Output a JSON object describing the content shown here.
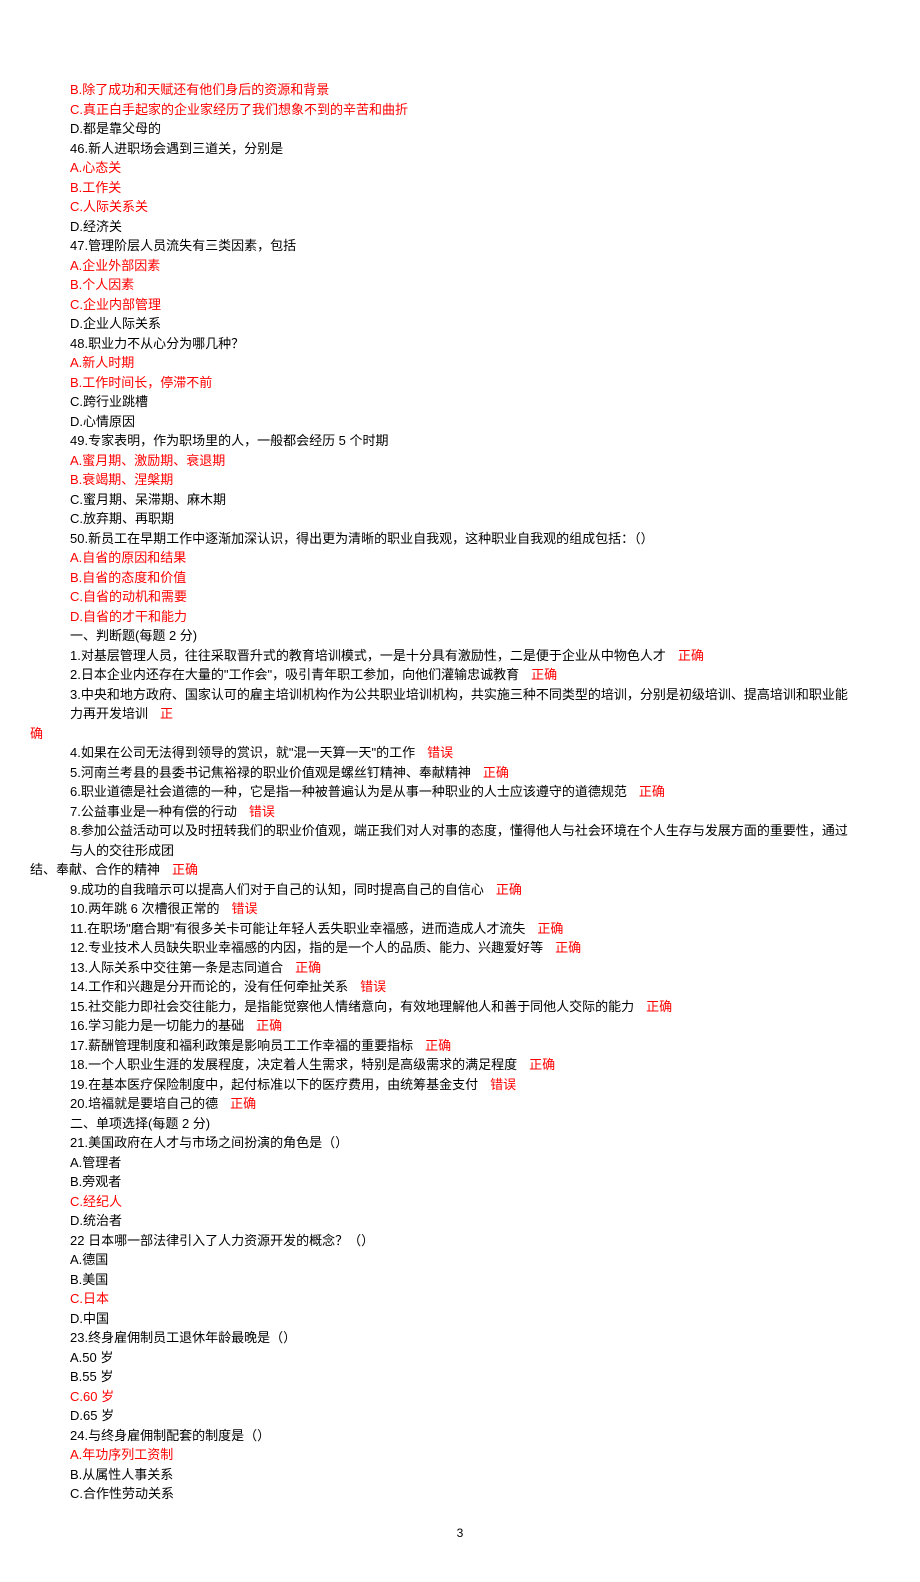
{
  "lines": [
    {
      "text": "B.除了成功和天赋还有他们身后的资源和背景",
      "red": true
    },
    {
      "text": "C.真正白手起家的企业家经历了我们想象不到的辛苦和曲折",
      "red": true
    },
    {
      "text": "D.都是靠父母的"
    },
    {
      "text": "46.新人进职场会遇到三道关，分别是"
    },
    {
      "text": "A.心态关",
      "red": true
    },
    {
      "text": "B.工作关",
      "red": true
    },
    {
      "text": "C.人际关系关",
      "red": true
    },
    {
      "text": "D.经济关"
    },
    {
      "text": "47.管理阶层人员流失有三类因素，包括"
    },
    {
      "text": "A.企业外部因素",
      "red": true
    },
    {
      "text": "B.个人因素",
      "red": true
    },
    {
      "text": "C.企业内部管理",
      "red": true
    },
    {
      "text": "D.企业人际关系"
    },
    {
      "text": "48.职业力不从心分为哪几种？"
    },
    {
      "text": "A.新人时期",
      "red": true
    },
    {
      "text": "B.工作时间长，停滞不前",
      "red": true
    },
    {
      "text": "C.跨行业跳槽"
    },
    {
      "text": "D.心情原因"
    },
    {
      "text": "49.专家表明，作为职场里的人，一般都会经历 5 个时期"
    },
    {
      "text": "A.蜜月期、激励期、衰退期",
      "red": true
    },
    {
      "text": "B.衰竭期、涅槃期",
      "red": true
    },
    {
      "text": "C.蜜月期、呆滞期、麻木期"
    },
    {
      "text": "C.放弃期、再职期"
    },
    {
      "text": "50.新员工在早期工作中逐渐加深认识，得出更为清晰的职业自我观，这种职业自我观的组成包括：（）"
    },
    {
      "text": "A.自省的原因和结果",
      "red": true
    },
    {
      "text": "B.自省的态度和价值",
      "red": true
    },
    {
      "text": "C.自省的动机和需要",
      "red": true
    },
    {
      "text": "D.自省的才干和能力",
      "red": true
    },
    {
      "text": "一、判断题(每题 2 分)"
    },
    {
      "text": "1.对基层管理人员，往往采取晋升式的教育培训模式，一是十分具有激励性，二是便于企业从中物色人才",
      "ans": "正确"
    },
    {
      "text": "2.日本企业内还存在大量的\"工作会\"，吸引青年职工参加，向他们灌输忠诚教育",
      "ans": "正确"
    },
    {
      "text": "3.中央和地方政府、国家认可的雇主培训机构作为公共职业培训机构，共实施三种不同类型的培训，分别是初级培训、提高培训和职业能力再开发培训",
      "ans": "正",
      "wrap": "确"
    },
    {
      "text": "4.如果在公司无法得到领导的赏识，就\"混一天算一天\"的工作",
      "ans": "错误"
    },
    {
      "text": "5.河南兰考县的县委书记焦裕禄的职业价值观是螺丝钉精神、奉献精神",
      "ans": "正确"
    },
    {
      "text": "6.职业道德是社会道德的一种，它是指一种被普遍认为是从事一种职业的人士应该遵守的道德规范",
      "ans": "正确"
    },
    {
      "text": "7.公益事业是一种有偿的行动",
      "ans": "错误"
    },
    {
      "text": "8.参加公益活动可以及时扭转我们的职业价值观，端正我们对人对事的态度，懂得他人与社会环境在个人生存与发展方面的重要性，通过与人的交往形成团",
      "wrap2": "结、奉献、合作的精神",
      "ans2": "正确"
    },
    {
      "text": "9.成功的自我暗示可以提高人们对于自己的认知，同时提高自己的自信心",
      "ans": "正确"
    },
    {
      "text": "10.两年跳 6 次槽很正常的",
      "ans": "错误"
    },
    {
      "text": "11.在职场\"磨合期\"有很多关卡可能让年轻人丢失职业幸福感，进而造成人才流失",
      "ans": "正确"
    },
    {
      "text": "12.专业技术人员缺失职业幸福感的内因，指的是一个人的品质、能力、兴趣爱好等",
      "ans": "正确"
    },
    {
      "text": "13.人际关系中交往第一条是志同道合",
      "ans": "正确"
    },
    {
      "text": "14.工作和兴趣是分开而论的，没有任何牵扯关系",
      "ans": "错误"
    },
    {
      "text": "15.社交能力即社会交往能力，是指能觉察他人情绪意向，有效地理解他人和善于同他人交际的能力",
      "ans": "正确"
    },
    {
      "text": "16.学习能力是一切能力的基础",
      "ans": "正确"
    },
    {
      "text": "17.薪酬管理制度和福利政策是影响员工工作幸福的重要指标",
      "ans": "正确"
    },
    {
      "text": "18.一个人职业生涯的发展程度，决定着人生需求，特别是高级需求的满足程度",
      "ans": "正确"
    },
    {
      "text": "19.在基本医疗保险制度中，起付标准以下的医疗费用，由统筹基金支付",
      "ans": "错误"
    },
    {
      "text": "20.培福就是要培自己的德",
      "ans": "正确"
    },
    {
      "text": "二、单项选择(每题 2 分)"
    },
    {
      "text": "21.美国政府在人才与市场之间扮演的角色是（）"
    },
    {
      "text": "A.管理者"
    },
    {
      "text": "B.旁观者"
    },
    {
      "text": "C.经纪人",
      "red": true
    },
    {
      "text": "D.统治者"
    },
    {
      "text": "22 日本哪一部法律引入了人力资源开发的概念？（）"
    },
    {
      "text": "A.德国"
    },
    {
      "text": "B.美国"
    },
    {
      "text": "C.日本",
      "red": true
    },
    {
      "text": "D.中国"
    },
    {
      "text": "23.终身雇佣制员工退休年龄最晚是（）"
    },
    {
      "text": "A.50 岁"
    },
    {
      "text": "B.55 岁"
    },
    {
      "text": "C.60 岁",
      "red": true
    },
    {
      "text": "D.65 岁"
    },
    {
      "text": "24.与终身雇佣制配套的制度是（）"
    },
    {
      "text": "A.年功序列工资制",
      "red": true
    },
    {
      "text": "B.从属性人事关系"
    },
    {
      "text": "C.合作性劳动关系"
    }
  ],
  "pageNumber": "3"
}
